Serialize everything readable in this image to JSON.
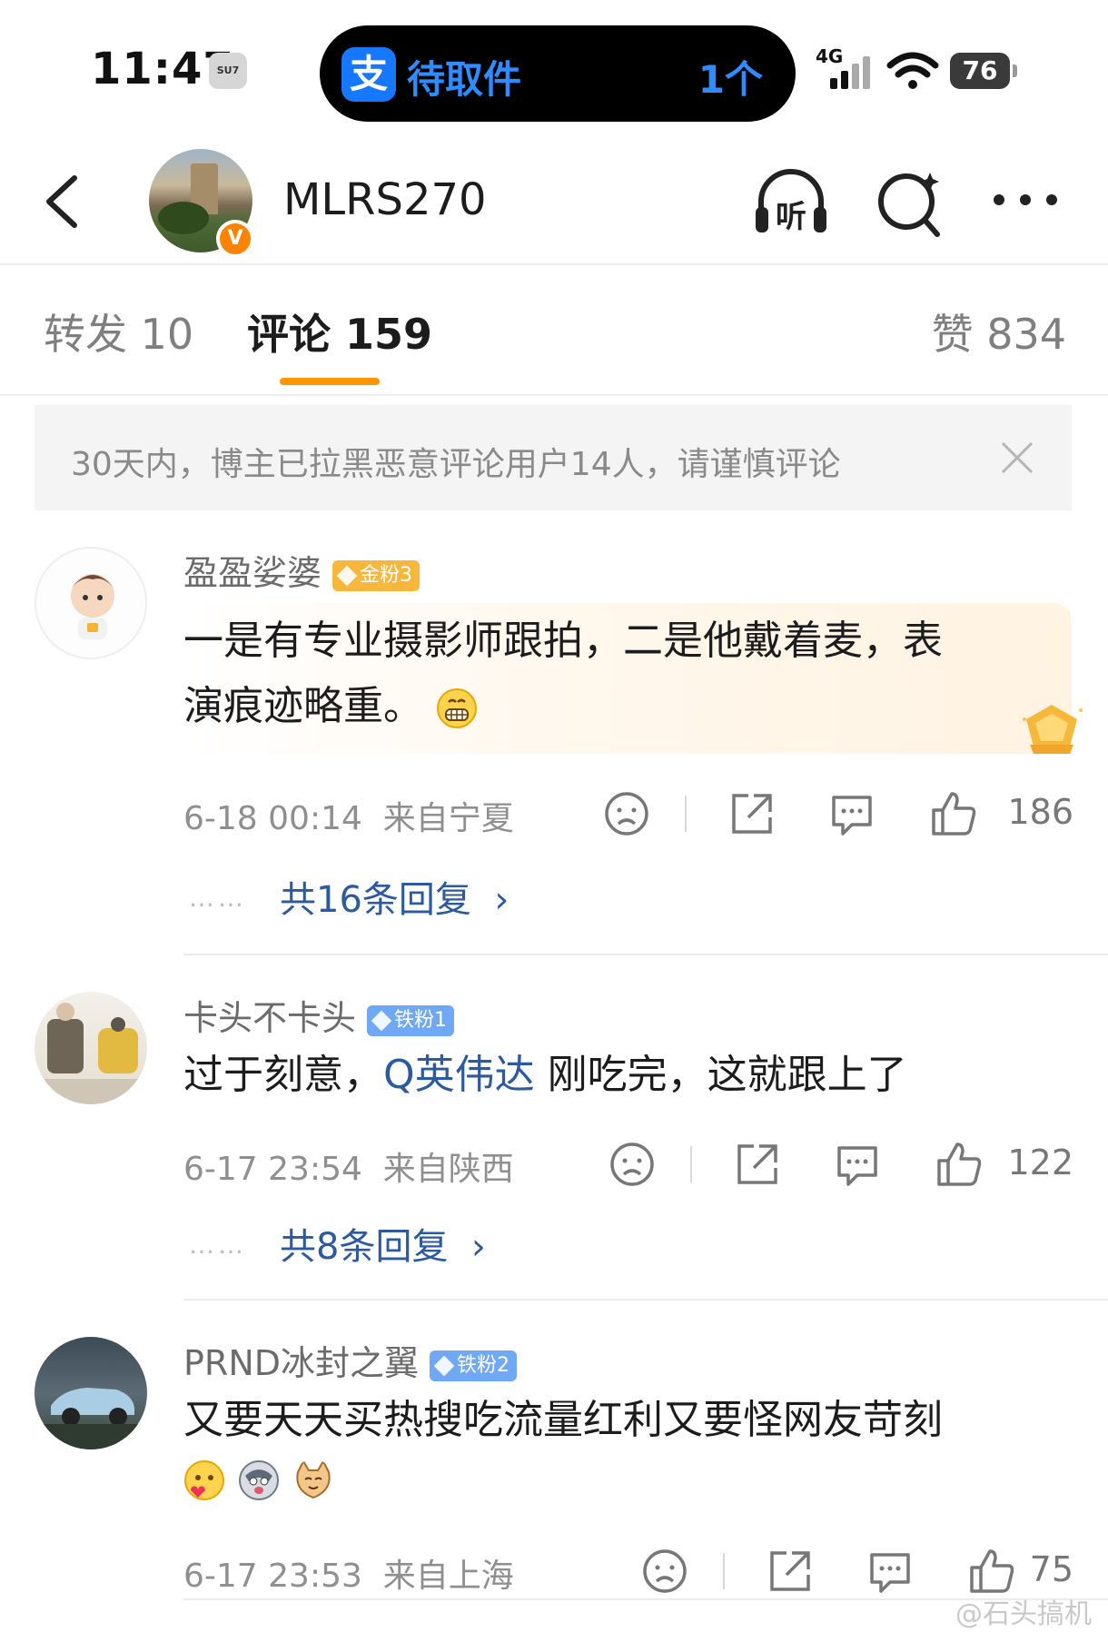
{
  "status_bar": {
    "time": "11:47",
    "car_badge": "SU7",
    "island_app_icon": "支",
    "island_label": "待取件",
    "island_count": "1个",
    "network": "4G",
    "battery": "76"
  },
  "header": {
    "username": "MLRS270",
    "verified_badge": "V",
    "listen_label": "听"
  },
  "tabs": [
    {
      "label": "转发 10"
    },
    {
      "label": "评论 159"
    },
    {
      "label": "赞 834"
    }
  ],
  "notice": {
    "text": "30天内，博主已拉黑恶意评论用户14人，请谨慎评论"
  },
  "comments": [
    {
      "username": "盈盈娑婆",
      "badge": "金粉3",
      "text_line1": "一是有专业摄影师跟拍，二是他戴着麦，表",
      "text_line2": "演痕迹略重。",
      "emoji": "grin-emoji",
      "time": "6-18 00:14",
      "location": "来自宁夏",
      "likes": "186",
      "replies": "共16条回复"
    },
    {
      "username": "卡头不卡头",
      "badge": "铁粉1",
      "text_before": "过于刻意，",
      "topic": "英伟达",
      "text_after": " 刚吃完，这就跟上了",
      "time": "6-17 23:54",
      "location": "来自陕西",
      "likes": "122",
      "replies": "共8条回复"
    },
    {
      "username": "PRND冰封之翼",
      "badge": "铁粉2",
      "text": "又要天天买热搜吃流量红利又要怪网友苛刻",
      "emojis": [
        "heart-face-emoji",
        "husky-emoji",
        "cat-emoji"
      ],
      "time": "6-17 23:53",
      "location": "来自上海",
      "likes": "75"
    }
  ],
  "watermark": "@石头搞机",
  "colors": {
    "accent": "#ff9500",
    "link": "#2b5a9e",
    "island_blue": "#2f8cff",
    "verified": "#ff8200"
  }
}
